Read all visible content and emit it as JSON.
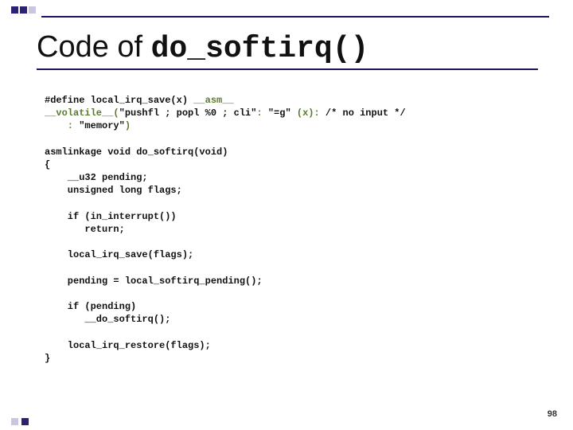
{
  "title": {
    "prefix": "Code of ",
    "mono": "do_softirq()"
  },
  "code": {
    "line1a": "#define local_irq_save(x) ",
    "line1b": "__asm__ ",
    "line2a": "__volatile__(",
    "line2b": "\"pushfl ; popl %0 ; cli\"",
    "line2c": ": ",
    "line2d": "\"=g\" ",
    "line2e": "(x): ",
    "line2f": "/* no input */",
    "line3a": "    : ",
    "line3b": "\"memory\"",
    "line3c": ")",
    "line5": "asmlinkage void do_softirq(void)",
    "line6": "{",
    "line7": "    __u32 pending;",
    "line8": "    unsigned long flags;",
    "line10": "    if (in_interrupt())",
    "line11": "       return;",
    "line13": "    local_irq_save(flags);",
    "line15": "    pending = local_softirq_pending();",
    "line17": "    if (pending)",
    "line18": "       __do_softirq();",
    "line20": "    local_irq_restore(flags);",
    "line21": "}"
  },
  "pagenum": "98"
}
